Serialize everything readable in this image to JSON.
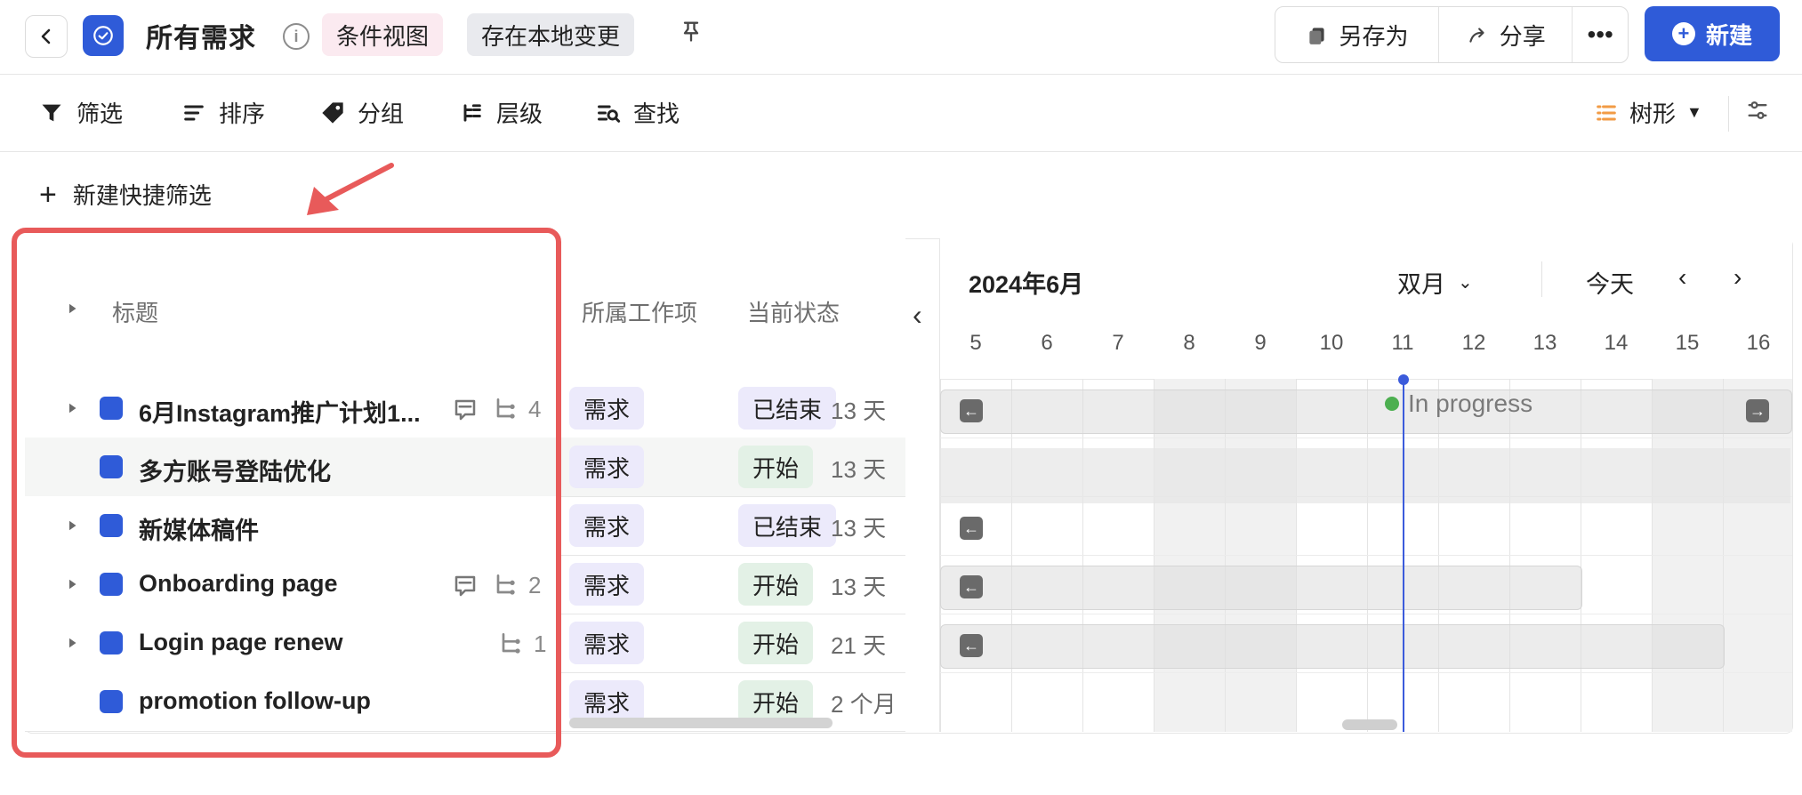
{
  "header": {
    "title": "所有需求",
    "chip_view": "条件视图",
    "chip_local": "存在本地变更",
    "actions": {
      "save_as": "另存为",
      "share": "分享",
      "more": "•••",
      "new": "新建"
    }
  },
  "toolbar": {
    "filter": "筛选",
    "sort": "排序",
    "group": "分组",
    "level": "层级",
    "find": "查找",
    "view_mode": "树形"
  },
  "quick_filter": {
    "label": "新建快捷筛选"
  },
  "table": {
    "columns": {
      "title": "标题",
      "work_item": "所属工作项",
      "status": "当前状态"
    },
    "rows": [
      {
        "title": "6月Instagram推广计划1...",
        "comment_icon": true,
        "sub_count": "4",
        "type": "需求",
        "status": "已结束",
        "duration": "13 天"
      },
      {
        "title": "多方账号登陆优化",
        "comment_icon": false,
        "sub_count": "",
        "type": "需求",
        "status": "开始",
        "duration": "13 天"
      },
      {
        "title": "新媒体稿件",
        "comment_icon": false,
        "sub_count": "",
        "type": "需求",
        "status": "已结束",
        "duration": "13 天"
      },
      {
        "title": "Onboarding page",
        "comment_icon": true,
        "sub_count": "2",
        "type": "需求",
        "status": "开始",
        "duration": "13 天"
      },
      {
        "title": "Login page renew",
        "comment_icon": false,
        "sub_count": "1",
        "type": "需求",
        "status": "开始",
        "duration": "21 天"
      },
      {
        "title": "promotion follow-up",
        "comment_icon": false,
        "sub_count": "",
        "type": "需求",
        "status": "开始",
        "duration": "2 个月"
      }
    ]
  },
  "gantt": {
    "month": "2024年6月",
    "mode": "双月",
    "today": "今天",
    "days": [
      "5",
      "6",
      "7",
      "8",
      "9",
      "10",
      "11",
      "12",
      "13",
      "14",
      "15",
      "16"
    ],
    "in_progress_label": "In progress"
  },
  "colors": {
    "brand_blue": "#2f5bd8",
    "highlight_red": "#e85a5a",
    "chip_lavender": "#eceafb",
    "chip_green": "#e3f1e6"
  }
}
